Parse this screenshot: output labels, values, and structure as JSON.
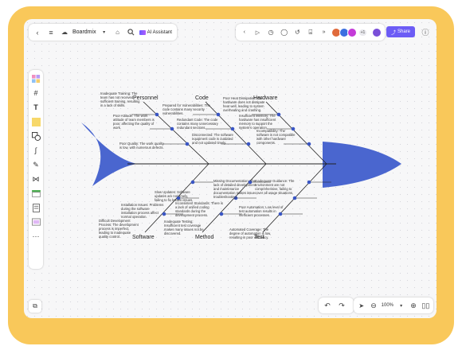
{
  "toolbar": {
    "doc_title": "Boardmix",
    "ai_label": "AI Assistant",
    "avatar_count": "+1",
    "share_label": "Share",
    "avatar_colors": [
      "#e06a3b",
      "#3b6fe0",
      "#c43bd8"
    ]
  },
  "zoom": {
    "level": "100%"
  },
  "diagram": {
    "categories": {
      "personnel": "Personnel",
      "code": "Code",
      "hardware": "Hardware",
      "software": "Software",
      "method": "Method",
      "test": "Test"
    },
    "notes": {
      "p1": [
        "Inadequate Training: The",
        "team has not received",
        "sufficient training, resulting",
        "in a lack of skills."
      ],
      "p2": [
        "Poor Attitude: The work",
        "attitude of team members is",
        "poor, affecting the quality of",
        "work."
      ],
      "p3": [
        "Poor Quality: The work quality",
        "is low, with numerous defects."
      ],
      "c1": [
        "Prepared for Vulnerabilities: The",
        "code contains many security",
        "vulnerabilities."
      ],
      "c2": [
        "Redundant Code: The code",
        "contains many unnecessary",
        "redundant sections."
      ],
      "c3": [
        "Disconnected: The software",
        "equipment code is outdated",
        "and not updated timely."
      ],
      "h1": [
        "Poor Heat Dissipation: The",
        "hardware does not dissipate",
        "heat well, leading to system",
        "overheating and crashing."
      ],
      "h2": [
        "Insufficient Memory: The",
        "hardware has insufficient",
        "memory to support the",
        "system's operation."
      ],
      "h3": [
        "Incompatibility: The",
        "software is not compatible",
        "with other hardware",
        "components."
      ],
      "s1": [
        "Slow Updates: Software",
        "updates are not timely,",
        "failing to fix known issues."
      ],
      "s2": [
        "Installation Issues: Problems",
        "during the software",
        "installation process affect",
        "normal operation."
      ],
      "s3": [
        "Difficult Development",
        "Process: The development",
        "process is imperfect,",
        "leading to inadequate",
        "quality control."
      ],
      "m1": [
        "Missing Documentation: The",
        "lack of detailed development",
        "and maintenance",
        "documentation makes issue",
        "troubleshooting."
      ],
      "m2": [
        "Inconsistent Standards: There is",
        "a lack of unified coding",
        "standards during the",
        "development process."
      ],
      "m3": [
        "Inadequate Testing:",
        "Insufficient test coverage",
        "makes many issues not be",
        "discovered."
      ],
      "t1": [
        "Inadequate Guidance: The",
        "environment are not",
        "comprehensive, failing to",
        "cover all usage situations."
      ],
      "t2": [
        "Poor Automation: Low level of",
        "test automation results in",
        "inefficient processes."
      ],
      "t3": [
        "Automated Coverage: The",
        "degree of automation is low,",
        "resulting in poor efficiency."
      ]
    }
  },
  "colors": {
    "fish": "#4a66cf",
    "share": "#6c5cf5",
    "frame": "#f9c85a"
  }
}
